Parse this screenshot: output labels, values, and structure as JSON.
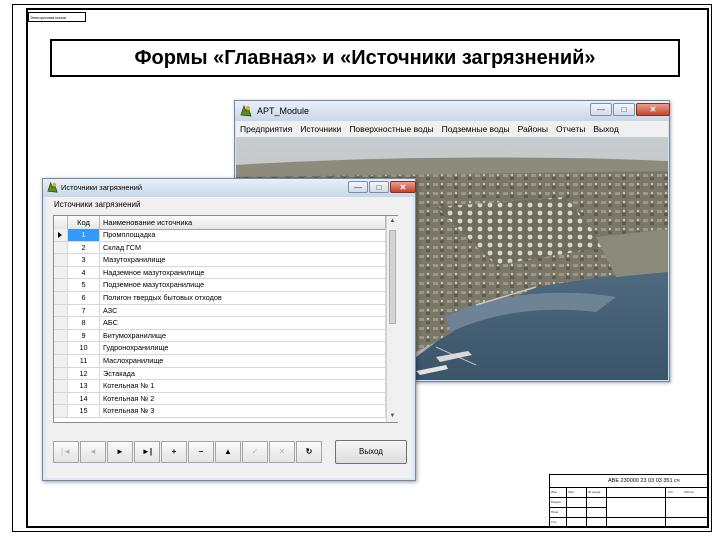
{
  "sheet": {
    "stamp_top": "Электронная копия",
    "title_block_code": "АВЕ 230000 23 03 03 351 сч",
    "title_block_tiny": [
      "Изм",
      "Лист",
      "№ докум.",
      "Подп.",
      "Дата",
      "Разраб.",
      "Пров.",
      "Н. контр.",
      "Утв.",
      "Лит.",
      "Лист",
      "Листов"
    ]
  },
  "slide": {
    "title": "Формы «Главная» и «Источники загрязнений»"
  },
  "main_window": {
    "title": "APT_Module",
    "icon": "app-module-icon",
    "menu": [
      "Предприятия",
      "Источники",
      "Поверхностные воды",
      "Подземные воды",
      "Районы",
      "Отчеты",
      "Выход"
    ],
    "controls": [
      "minimize",
      "maximize",
      "close"
    ],
    "photo": "aerial-industrial-port-photo"
  },
  "sources_window": {
    "title": "Источники загрязнений",
    "heading": "Источники загрязнений",
    "columns": {
      "code": "Код",
      "name": "Наименование источника"
    },
    "rows": [
      {
        "code": "1",
        "name": "Промплощадка"
      },
      {
        "code": "2",
        "name": "Склад ГСМ"
      },
      {
        "code": "3",
        "name": "Мазутохранилище"
      },
      {
        "code": "4",
        "name": "Надземное мазутохранилище"
      },
      {
        "code": "5",
        "name": "Подземное мазутохранилище"
      },
      {
        "code": "6",
        "name": "Полигон твердых бытовых отходов"
      },
      {
        "code": "7",
        "name": "АЗС"
      },
      {
        "code": "8",
        "name": "АБС"
      },
      {
        "code": "9",
        "name": "Битумохранилище"
      },
      {
        "code": "10",
        "name": "Гудронохранилище"
      },
      {
        "code": "11",
        "name": "Маслохранилище"
      },
      {
        "code": "12",
        "name": "Эстакада"
      },
      {
        "code": "13",
        "name": "Котельная № 1"
      },
      {
        "code": "14",
        "name": "Котельная № 2"
      },
      {
        "code": "15",
        "name": "Котельная № 3"
      }
    ],
    "selected_row": 0,
    "navigator": [
      {
        "name": "first",
        "glyph": "|◄",
        "enabled": false
      },
      {
        "name": "prior",
        "glyph": "◄",
        "enabled": false
      },
      {
        "name": "next",
        "glyph": "►",
        "enabled": true
      },
      {
        "name": "last",
        "glyph": "►|",
        "enabled": true
      },
      {
        "name": "insert",
        "glyph": "+",
        "enabled": true
      },
      {
        "name": "delete",
        "glyph": "−",
        "enabled": true
      },
      {
        "name": "edit",
        "glyph": "▲",
        "enabled": true
      },
      {
        "name": "post",
        "glyph": "✓",
        "enabled": false
      },
      {
        "name": "cancel",
        "glyph": "✕",
        "enabled": false
      },
      {
        "name": "refresh",
        "glyph": "↻",
        "enabled": true
      }
    ],
    "exit_label": "Выход"
  },
  "colors": {
    "selection": "#3399ff",
    "window_frame": "#d6e2ef",
    "close_button": "#c5432f"
  }
}
